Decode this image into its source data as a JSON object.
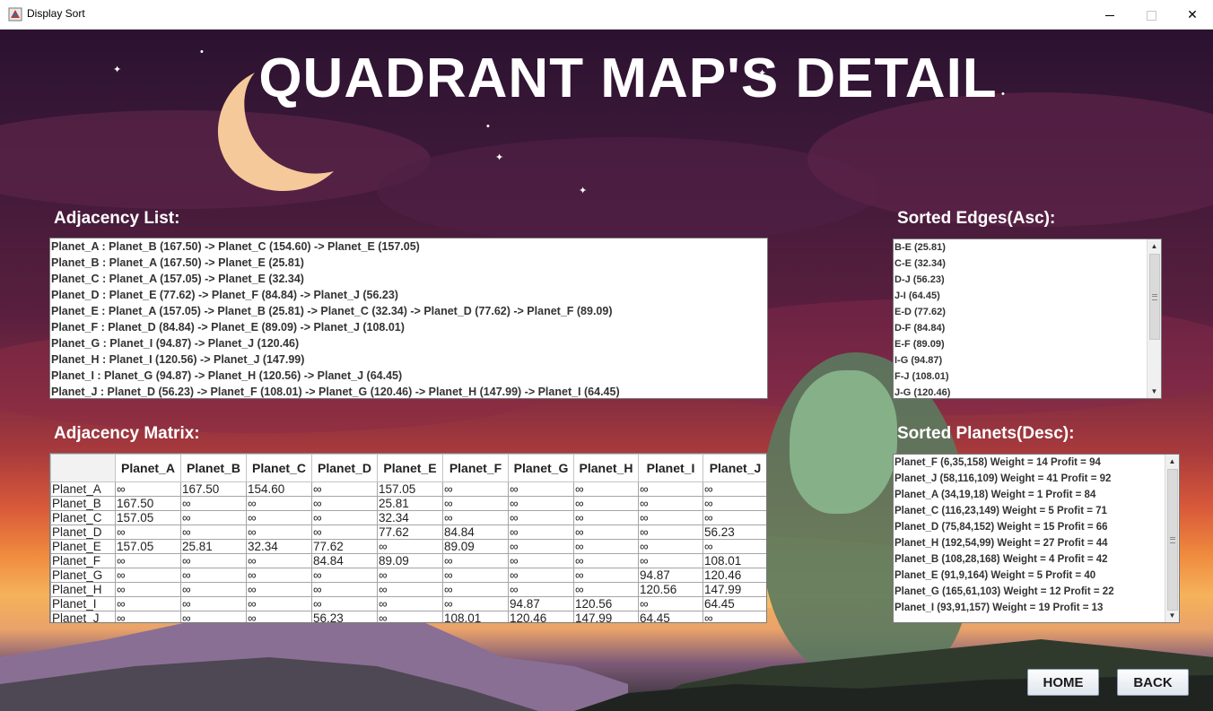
{
  "window": {
    "title": "Display Sort",
    "min": "",
    "max": "",
    "close": "✕"
  },
  "heading": "QUADRANT MAP'S DETAIL",
  "adjacency_list": {
    "label": "Adjacency List:",
    "rows": [
      "Planet_A : Planet_B (167.50) -> Planet_C (154.60) -> Planet_E (157.05)",
      "Planet_B : Planet_A (167.50) -> Planet_E (25.81)",
      "Planet_C : Planet_A (157.05) -> Planet_E (32.34)",
      "Planet_D : Planet_E (77.62) -> Planet_F (84.84) -> Planet_J (56.23)",
      "Planet_E : Planet_A (157.05) -> Planet_B (25.81) -> Planet_C (32.34) -> Planet_D (77.62) -> Planet_F (89.09)",
      "Planet_F : Planet_D (84.84) -> Planet_E (89.09) -> Planet_J (108.01)",
      "Planet_G : Planet_I (94.87) -> Planet_J (120.46)",
      "Planet_H : Planet_I (120.56) -> Planet_J (147.99)",
      "Planet_I : Planet_G (94.87) -> Planet_H (120.56) -> Planet_J (64.45)",
      "Planet_J : Planet_D (56.23) -> Planet_F (108.01) -> Planet_G (120.46) -> Planet_H (147.99) -> Planet_I (64.45)"
    ]
  },
  "sorted_edges": {
    "label": "Sorted Edges(Asc):",
    "rows": [
      "B-E (25.81)",
      "C-E (32.34)",
      "D-J (56.23)",
      "J-I (64.45)",
      "E-D (77.62)",
      "D-F (84.84)",
      "E-F (89.09)",
      "I-G (94.87)",
      "F-J (108.01)",
      "J-G (120.46)"
    ]
  },
  "adjacency_matrix": {
    "label": "Adjacency Matrix:",
    "columns": [
      "",
      "Planet_A",
      "Planet_B",
      "Planet_C",
      "Planet_D",
      "Planet_E",
      "Planet_F",
      "Planet_G",
      "Planet_H",
      "Planet_I",
      "Planet_J"
    ],
    "rows": [
      [
        "Planet_A",
        "∞",
        "167.50",
        "154.60",
        "∞",
        "157.05",
        "∞",
        "∞",
        "∞",
        "∞",
        "∞"
      ],
      [
        "Planet_B",
        "167.50",
        "∞",
        "∞",
        "∞",
        "25.81",
        "∞",
        "∞",
        "∞",
        "∞",
        "∞"
      ],
      [
        "Planet_C",
        "157.05",
        "∞",
        "∞",
        "∞",
        "32.34",
        "∞",
        "∞",
        "∞",
        "∞",
        "∞"
      ],
      [
        "Planet_D",
        "∞",
        "∞",
        "∞",
        "∞",
        "77.62",
        "84.84",
        "∞",
        "∞",
        "∞",
        "56.23"
      ],
      [
        "Planet_E",
        "157.05",
        "25.81",
        "32.34",
        "77.62",
        "∞",
        "89.09",
        "∞",
        "∞",
        "∞",
        "∞"
      ],
      [
        "Planet_F",
        "∞",
        "∞",
        "∞",
        "84.84",
        "89.09",
        "∞",
        "∞",
        "∞",
        "∞",
        "108.01"
      ],
      [
        "Planet_G",
        "∞",
        "∞",
        "∞",
        "∞",
        "∞",
        "∞",
        "∞",
        "∞",
        "94.87",
        "120.46"
      ],
      [
        "Planet_H",
        "∞",
        "∞",
        "∞",
        "∞",
        "∞",
        "∞",
        "∞",
        "∞",
        "120.56",
        "147.99"
      ],
      [
        "Planet_I",
        "∞",
        "∞",
        "∞",
        "∞",
        "∞",
        "∞",
        "94.87",
        "120.56",
        "∞",
        "64.45"
      ],
      [
        "Planet_J",
        "∞",
        "∞",
        "∞",
        "56.23",
        "∞",
        "108.01",
        "120.46",
        "147.99",
        "64.45",
        "∞"
      ]
    ]
  },
  "sorted_planets": {
    "label": "Sorted Planets(Desc):",
    "rows": [
      "Planet_F (6,35,158) Weight = 14 Profit = 94",
      "Planet_J (58,116,109) Weight = 41 Profit = 92",
      "Planet_A (34,19,18) Weight = 1 Profit = 84",
      "Planet_C (116,23,149) Weight = 5 Profit = 71",
      "Planet_D (75,84,152) Weight = 15 Profit = 66",
      "Planet_H (192,54,99) Weight = 27 Profit = 44",
      "Planet_B (108,28,168) Weight = 4 Profit = 42",
      "Planet_E (91,9,164) Weight = 5 Profit = 40",
      "Planet_G (165,61,103) Weight = 12 Profit = 22",
      "Planet_I (93,91,157) Weight = 19 Profit = 13"
    ]
  },
  "buttons": {
    "home": "HOME",
    "back": "BACK"
  },
  "icons": {
    "app": "app-icon",
    "scroll_up": "▲",
    "scroll_down": "▼"
  }
}
